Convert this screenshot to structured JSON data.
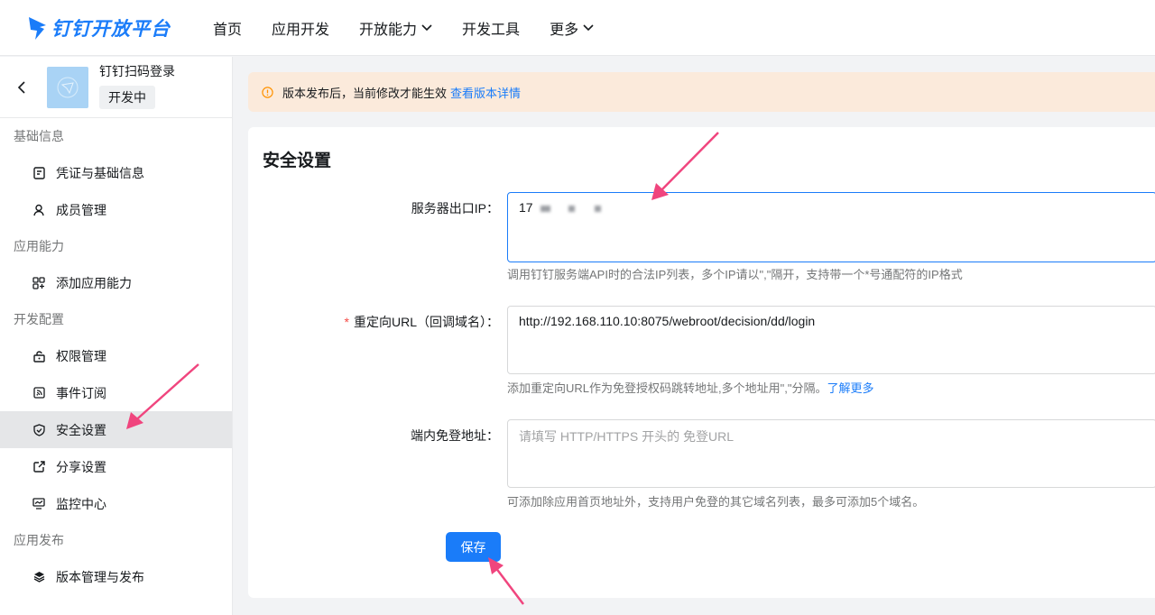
{
  "brand": {
    "name": "钉钉开放平台"
  },
  "nav": {
    "items": [
      {
        "label": "首页",
        "has_dropdown": false
      },
      {
        "label": "应用开发",
        "has_dropdown": false
      },
      {
        "label": "开放能力",
        "has_dropdown": true
      },
      {
        "label": "开发工具",
        "has_dropdown": false
      },
      {
        "label": "更多",
        "has_dropdown": true
      }
    ]
  },
  "app": {
    "name": "钉钉扫码登录",
    "status": "开发中"
  },
  "sidebar": {
    "groups": [
      {
        "title": "基础信息",
        "items": [
          {
            "label": "凭证与基础信息",
            "icon": "credential-icon"
          },
          {
            "label": "成员管理",
            "icon": "member-icon"
          }
        ]
      },
      {
        "title": "应用能力",
        "items": [
          {
            "label": "添加应用能力",
            "icon": "grid-plus-icon"
          }
        ]
      },
      {
        "title": "开发配置",
        "items": [
          {
            "label": "权限管理",
            "icon": "lock-icon"
          },
          {
            "label": "事件订阅",
            "icon": "rss-icon"
          },
          {
            "label": "安全设置",
            "icon": "shield-icon",
            "active": true
          },
          {
            "label": "分享设置",
            "icon": "share-icon"
          },
          {
            "label": "监控中心",
            "icon": "monitor-icon"
          }
        ]
      },
      {
        "title": "应用发布",
        "items": [
          {
            "label": "版本管理与发布",
            "icon": "layers-icon"
          }
        ]
      }
    ]
  },
  "notice": {
    "text": "版本发布后，当前修改才能生效",
    "link": "查看版本详情"
  },
  "page": {
    "title": "安全设置"
  },
  "form": {
    "server_ip": {
      "label": "服务器出口IP：",
      "value_prefix": "17",
      "help": "调用钉钉服务端API时的合法IP列表，多个IP请以\",\"隔开，支持带一个*号通配符的IP格式"
    },
    "redirect_url": {
      "required_mark": "*",
      "label": "重定向URL（回调域名）：",
      "value": "http://192.168.110.10:8075/webroot/decision/dd/login",
      "help": "添加重定向URL作为免登授权码跳转地址,多个地址用\",\"分隔。",
      "help_link": "了解更多"
    },
    "sso_url": {
      "label": "端内免登地址：",
      "placeholder": "请填写 HTTP/HTTPS 开头的 免登URL",
      "help": "可添加除应用首页地址外，支持用户免登的其它域名列表，最多可添加5个域名。"
    },
    "save_label": "保存"
  },
  "colors": {
    "accent": "#1a7cf9",
    "notice_bg": "#fbeadb",
    "annotation_arrow": "#f0457e",
    "required": "#f54a45"
  }
}
